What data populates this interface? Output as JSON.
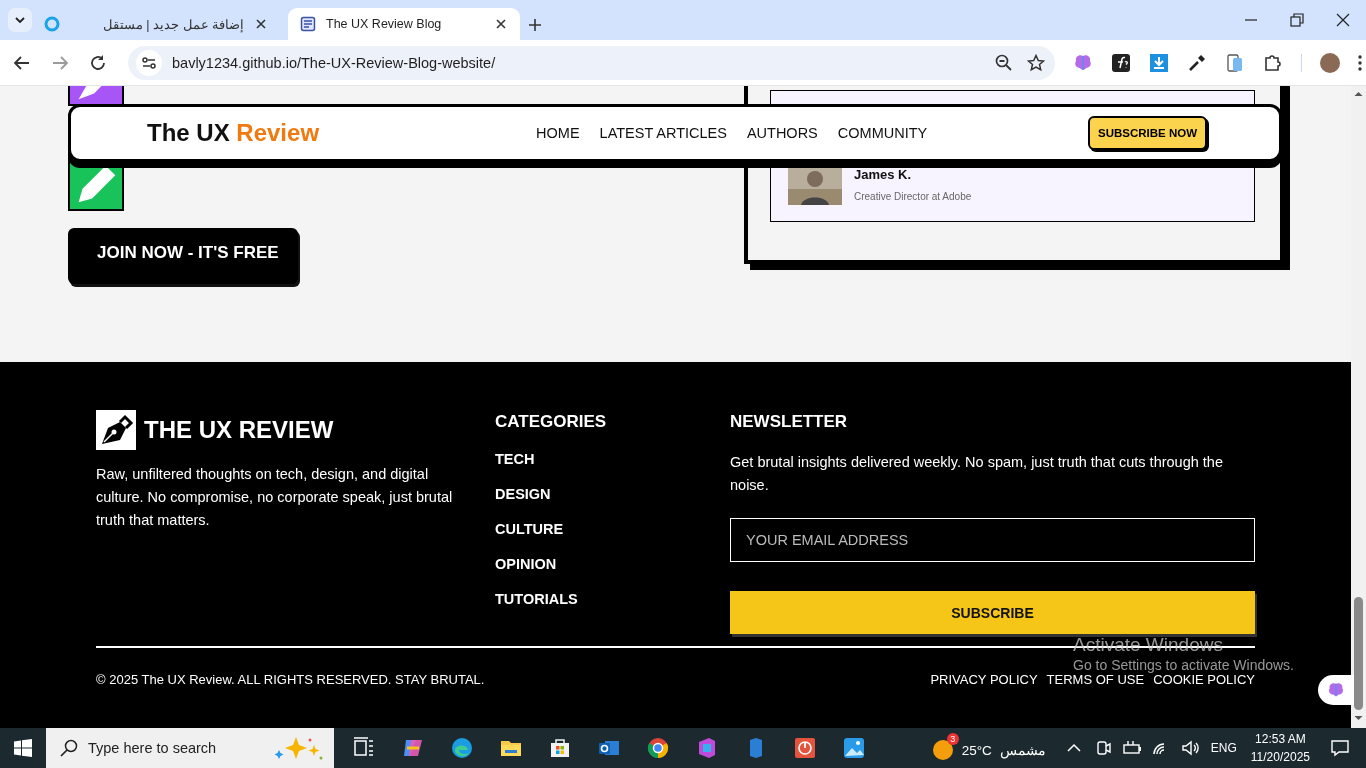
{
  "browser": {
    "tabs": [
      {
        "title": "إضافة عمل جديد | مستقل",
        "selected": false
      },
      {
        "title": "The UX Review Blog",
        "selected": true
      }
    ],
    "address": "bavly1234.github.io/The-UX-Review-Blog-website/"
  },
  "page": {
    "header": {
      "logo_parts": [
        "The UX",
        "Review"
      ],
      "nav": [
        "HOME",
        "LATEST ARTICLES",
        "AUTHORS",
        "COMMUNITY"
      ],
      "cta": "SUBSCRIBE NOW"
    },
    "join_button": "JOIN NOW - IT'S FREE",
    "testimonial": {
      "name": "James K.",
      "role": "Creative Director at Adobe"
    },
    "footer": {
      "brand": "THE UX REVIEW",
      "about": "Raw, unfiltered thoughts on tech, design, and digital culture. No compromise, no corporate speak, just brutal truth that matters.",
      "categories": {
        "heading": "CATEGORIES",
        "links": [
          "TECH",
          "DESIGN",
          "CULTURE",
          "OPINION",
          "TUTORIALS"
        ]
      },
      "newsletter": {
        "heading": "NEWSLETTER",
        "text": "Get brutal insights delivered weekly. No spam, just truth that cuts through the noise.",
        "placeholder": "YOUR EMAIL ADDRESS",
        "button": "SUBSCRIBE"
      },
      "copyright": "© 2025 The UX Review. ALL RIGHTS RESERVED. STAY BRUTAL.",
      "legal_links": [
        "PRIVACY POLICY",
        "TERMS OF USE",
        "COOKIE POLICY"
      ]
    }
  },
  "os_overlay": {
    "title": "Activate Windows",
    "text": "Go to Settings to activate Windows."
  },
  "taskbar": {
    "search_placeholder": "Type here to search",
    "weather": {
      "badge": "3",
      "temperature": "25°C",
      "condition": "مشمس"
    },
    "language": "ENG",
    "time": "12:53 AM",
    "date": "11/20/2025"
  }
}
